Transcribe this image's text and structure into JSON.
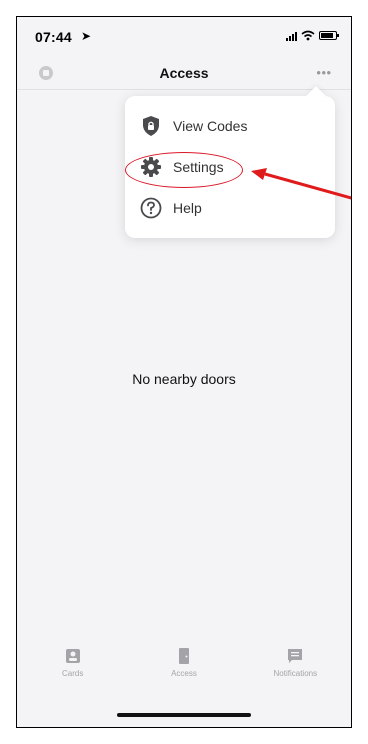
{
  "status_bar": {
    "time": "07:44",
    "location_icon": "location-arrow-icon",
    "signal_icon": "signal-icon",
    "wifi_icon": "wifi-icon",
    "battery_icon": "battery-icon"
  },
  "nav": {
    "title": "Access",
    "left_icon": "stop-icon",
    "more_label": "•••"
  },
  "dropdown": {
    "items": [
      {
        "label": "View Codes",
        "icon": "shield-lock-icon"
      },
      {
        "label": "Settings",
        "icon": "gear-icon"
      },
      {
        "label": "Help",
        "icon": "question-circle-icon"
      }
    ]
  },
  "annotation": {
    "highlight_color": "#d81b2a",
    "arrow_color": "#e01b1b"
  },
  "main": {
    "empty_message": "No nearby doors"
  },
  "tabs": [
    {
      "label": "Cards",
      "icon": "card-icon"
    },
    {
      "label": "Access",
      "icon": "door-icon"
    },
    {
      "label": "Notifications",
      "icon": "message-icon"
    }
  ],
  "colors": {
    "background": "#f4f4f6",
    "menu_text": "#333333",
    "icon_dark": "#4a4a4e",
    "tab_inactive": "#a4a4a8"
  }
}
